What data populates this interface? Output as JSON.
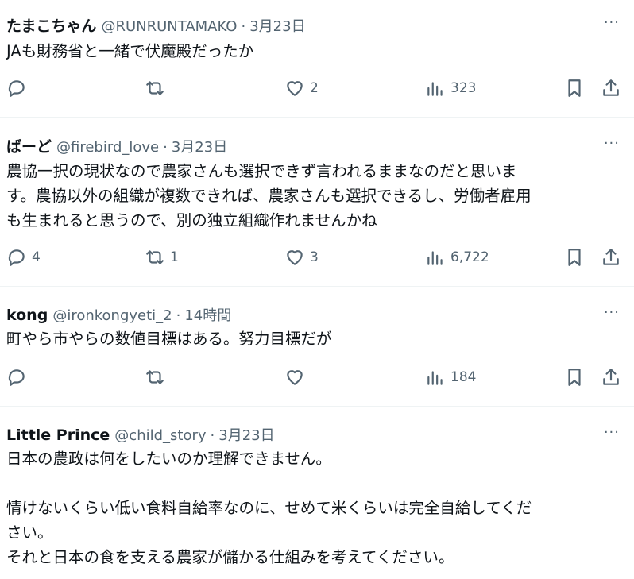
{
  "tweets": [
    {
      "name": "たまこちゃん",
      "handle": "@RUNRUNTAMAKO",
      "separator": "·",
      "time": "3月23日",
      "more": "···",
      "lines": [
        "JAも財務省と一緒で伏魔殿だったか"
      ],
      "reply_count": "",
      "retweet_count": "",
      "like_count": "2",
      "view_count": "323"
    },
    {
      "name": "ばーど",
      "handle": "@firebird_love",
      "separator": "·",
      "time": "3月23日",
      "more": "···",
      "lines": [
        "農協一択の現状なので農家さんも選択できず言われるままなのだと思いま",
        "す。農協以外の組織が複数できれば、農家さんも選択できるし、労働者雇用",
        "も生まれると思うので、別の独立組織作れませんかね"
      ],
      "reply_count": "4",
      "retweet_count": "1",
      "like_count": "3",
      "view_count": "6,722"
    },
    {
      "name": "kong",
      "handle": "@ironkongyeti_2",
      "separator": "·",
      "time": "14時間",
      "more": "···",
      "lines": [
        "町やら市やらの数値目標はある。努力目標だが"
      ],
      "reply_count": "",
      "retweet_count": "",
      "like_count": "",
      "view_count": "184"
    },
    {
      "name": "Little Prince",
      "handle": "@child_story",
      "separator": "·",
      "time": "3月23日",
      "more": "···",
      "lines": [
        "日本の農政は何をしたいのか理解できません。",
        "",
        "情けないくらい低い食料自給率なのに、せめて米くらいは完全自給してくだ",
        "さい。",
        "それと日本の食を支える農家が儲かる仕組みを考えてください。"
      ]
    }
  ],
  "icons": {
    "reply": "reply-icon",
    "retweet": "retweet-icon",
    "like": "heart-icon",
    "views": "views-icon",
    "bookmark": "bookmark-icon",
    "share": "share-icon"
  },
  "colors": {
    "text": "#0f1419",
    "secondary": "#536471",
    "divider": "#eff3f4"
  }
}
